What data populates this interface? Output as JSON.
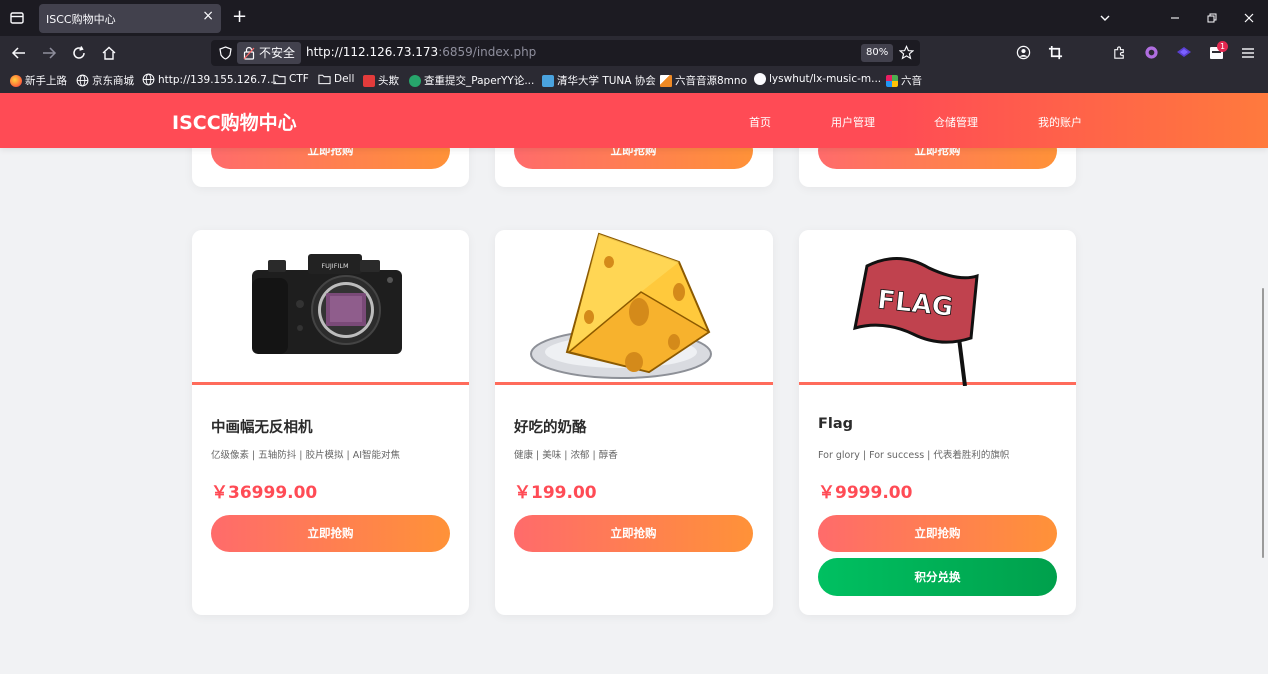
{
  "browser": {
    "tab_title": "ISCC购物中心",
    "tab_close": "×",
    "new_tab": "+",
    "insecure_label": "不安全",
    "url_host": "http://112.126.73.173",
    "url_rest": ":6859/index.php",
    "zoom": "80%",
    "extension_badge": "1",
    "bookmarks": [
      {
        "label": "新手上路",
        "icon": "firefox-icon",
        "color": "#ff7139"
      },
      {
        "label": "京东商城",
        "icon": "globe-icon",
        "color": ""
      },
      {
        "label": "http://139.155.126.7...",
        "icon": "globe-icon",
        "color": ""
      },
      {
        "label": "CTF",
        "icon": "folder-icon",
        "color": ""
      },
      {
        "label": "Dell",
        "icon": "folder-icon",
        "color": ""
      },
      {
        "label": "头欺",
        "icon": "toutiao-icon",
        "color": "#e33b3b"
      },
      {
        "label": "查重提交_PaperYY论...",
        "icon": "paperyy-icon",
        "color": "#27a56b"
      },
      {
        "label": "清华大学 TUNA 协会",
        "icon": "tuna-icon",
        "color": "#4aa3df"
      },
      {
        "label": "六音音源8mno",
        "icon": "picture-icon",
        "color": "#f08a24"
      },
      {
        "label": "lyswhut/lx-music-m...",
        "icon": "github-icon",
        "color": "#ffffff"
      },
      {
        "label": "六音",
        "icon": "puzzle-icon",
        "color": "#4caf50"
      }
    ]
  },
  "site": {
    "logo": "ISCC购物中心",
    "menu": [
      "首页",
      "用户管理",
      "仓储管理",
      "我的账户"
    ]
  },
  "top_row_buttons": [
    "立即抢购",
    "立即抢购",
    "立即抢购"
  ],
  "products": [
    {
      "name": "中画幅无反相机",
      "desc": "亿级像素 | 五轴防抖 | 胶片模拟 | AI智能对焦",
      "price": "￥36999.00",
      "buy_label": "立即抢购",
      "image": "camera-image",
      "brand_text": "FUJIFILM"
    },
    {
      "name": "好吃的奶酪",
      "desc": "健康 | 美味 | 浓郁 | 醇香",
      "price": "￥199.00",
      "buy_label": "立即抢购",
      "image": "cheese-image"
    },
    {
      "name": "Flag",
      "desc": "For glory | For success | 代表着胜利的旗帜",
      "price": "￥9999.00",
      "buy_label": "立即抢购",
      "exchange_label": "积分兑换",
      "image": "flag-image",
      "flag_text": "FLAG"
    }
  ],
  "colors": {
    "header_start": "#ff4b55",
    "header_end": "#ff7a3d",
    "price": "#ff4b55",
    "buy_start": "#ff6b6b",
    "buy_end": "#ff9238",
    "exchange": "#00b259"
  }
}
